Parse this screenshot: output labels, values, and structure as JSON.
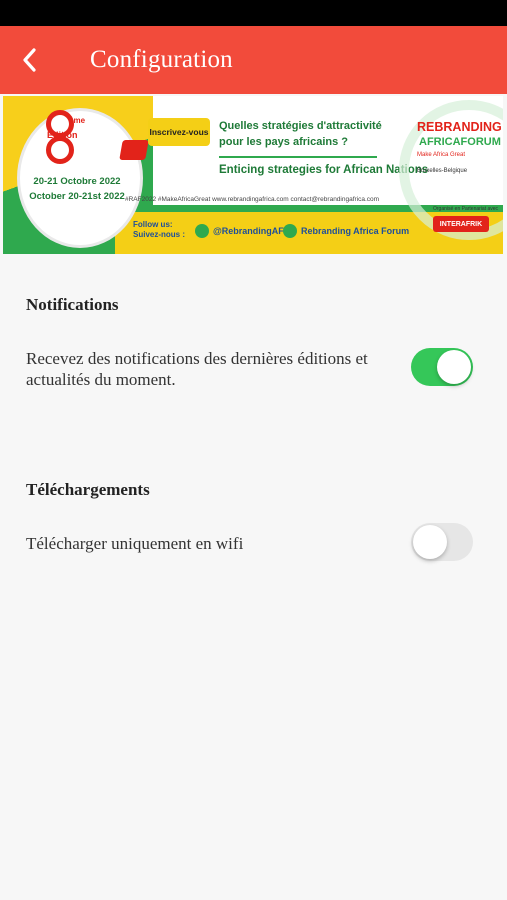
{
  "header": {
    "title": "Configuration",
    "back_icon": "chevron-left-icon"
  },
  "banner": {
    "edition_number_sup": "ème",
    "edition_label": "Edition",
    "date_fr": "20-21 Octobre 2022",
    "date_en": "October 20-21st 2022",
    "cta": "Inscrivez-vous",
    "question_fr_line1": "Quelles stratégies d'attractivité",
    "question_fr_line2": "pour les pays africains ?",
    "subtitle_en": "Enticing strategies for African Nations",
    "hashtags": "#RAF2022   #MakeAfricaGreat   www.rebrandingafrica.com   contact@rebrandingafrica.com",
    "follow_label": "Follow us:\nSuivez-nous :",
    "social_twitter": "@RebrandingAF",
    "social_linkedin": "Rebranding Africa Forum",
    "logo_line1": "REBRANDING",
    "logo_line2": "AFRICAFORUM",
    "logo_line3": "Make Africa Great",
    "logo_line4": "Bruxelles-Belgique",
    "partner_label": "Organisé en Partenariat avec",
    "partner_name": "INTERAFRIK"
  },
  "sections": {
    "notifications": {
      "title": "Notifications",
      "setting_label": "Recevez des notifications des dernières éditions et actualités du moment.",
      "enabled": true
    },
    "downloads": {
      "title": "Téléchargements",
      "setting_label": "Télécharger uniquement en wifi",
      "enabled": false
    }
  },
  "colors": {
    "app_bar": "#f24b3b",
    "toggle_on": "#35c759",
    "toggle_off": "#e6e6e6",
    "background": "#f7f7f7"
  }
}
